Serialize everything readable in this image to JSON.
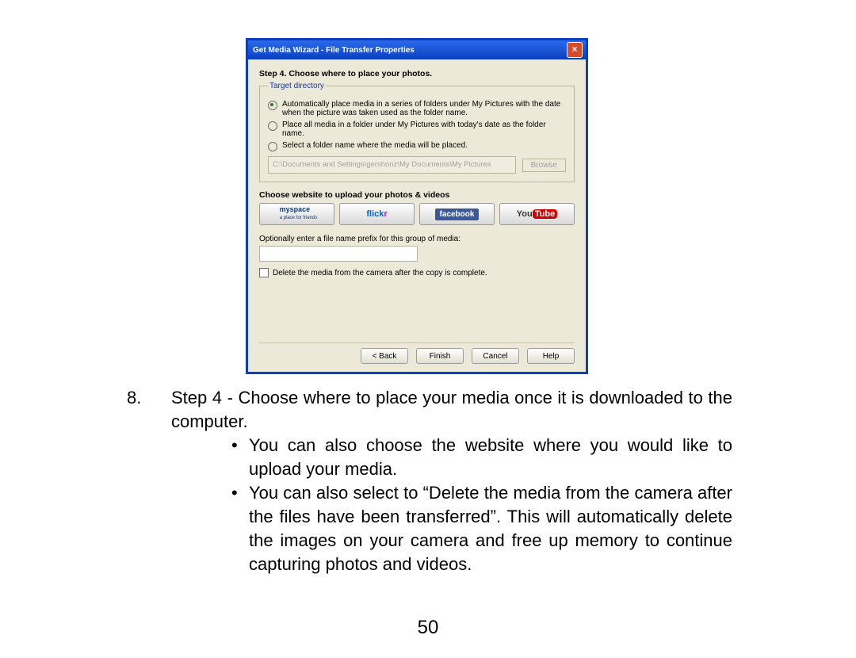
{
  "dialog": {
    "title": "Get Media Wizard - File Transfer Properties",
    "step_head": "Step 4. Choose where to place your photos.",
    "fieldset_legend": "Target directory",
    "radio1": "Automatically place media in a series of folders under My Pictures with the date when the picture was taken used as the folder name.",
    "radio2": "Place all media in a folder under My Pictures with today's date as the folder name.",
    "radio3": "Select a folder name where the media will be placed.",
    "path": "C:\\Documents and Settings\\gershonz\\My Documents\\My Pictures",
    "browse": "Browse",
    "upload_head": "Choose website to upload your photos & videos",
    "myspace": "myspace",
    "myspace_sub": "a place for friends",
    "flickr_a": "flick",
    "flickr_b": "r",
    "facebook": "facebook",
    "yt_you": "You",
    "yt_tube": "Tube",
    "opt_label": "Optionally enter a file name prefix for this group of media:",
    "delete_label": "Delete the media from the camera after the copy is complete.",
    "btn_back": "< Back",
    "btn_finish": "Finish",
    "btn_cancel": "Cancel",
    "btn_help": "Help"
  },
  "doc": {
    "item_num": "8.",
    "item_text": "Step 4 - Choose where to place your media once it is downloaded to the computer.",
    "bullet1": "You can also choose the website where you would like to upload your media.",
    "bullet2": "You can also select to “Delete the media from the camera after the files have been transferred”. This will automatically delete the images on your camera and free up memory to continue capturing photos and videos.",
    "page": "50"
  }
}
